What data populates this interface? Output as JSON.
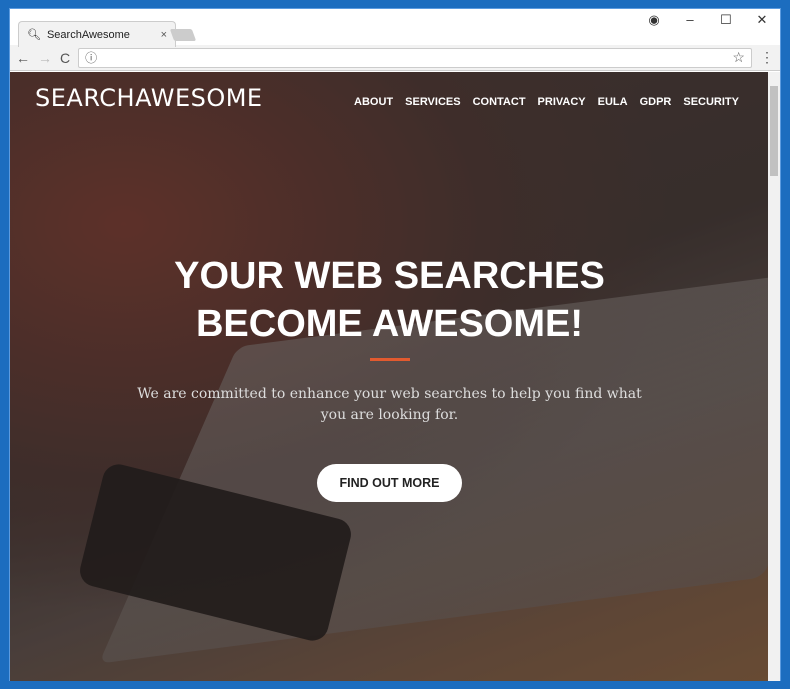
{
  "browser": {
    "tab_title": "SearchAwesome",
    "url": "",
    "tab_close": "×",
    "window_controls": {
      "profile": "◉",
      "minimize": "–",
      "maximize": "☐",
      "close": "✕"
    },
    "icons": {
      "back": "←",
      "forward": "→",
      "reload": "C",
      "info": "ⓘ",
      "bookmark": "☆",
      "menu": "⋮"
    }
  },
  "site": {
    "logo": "SEARCHAWESOME",
    "nav": [
      "ABOUT",
      "SERVICES",
      "CONTACT",
      "PRIVACY",
      "EULA",
      "GDPR",
      "SECURITY"
    ],
    "headline": "YOUR WEB SEARCHES BECOME AWESOME!",
    "subtext": "We are committed to enhance your web searches to help you find what you are looking for.",
    "cta": "FIND OUT MORE",
    "accent": "#e25a2f"
  }
}
